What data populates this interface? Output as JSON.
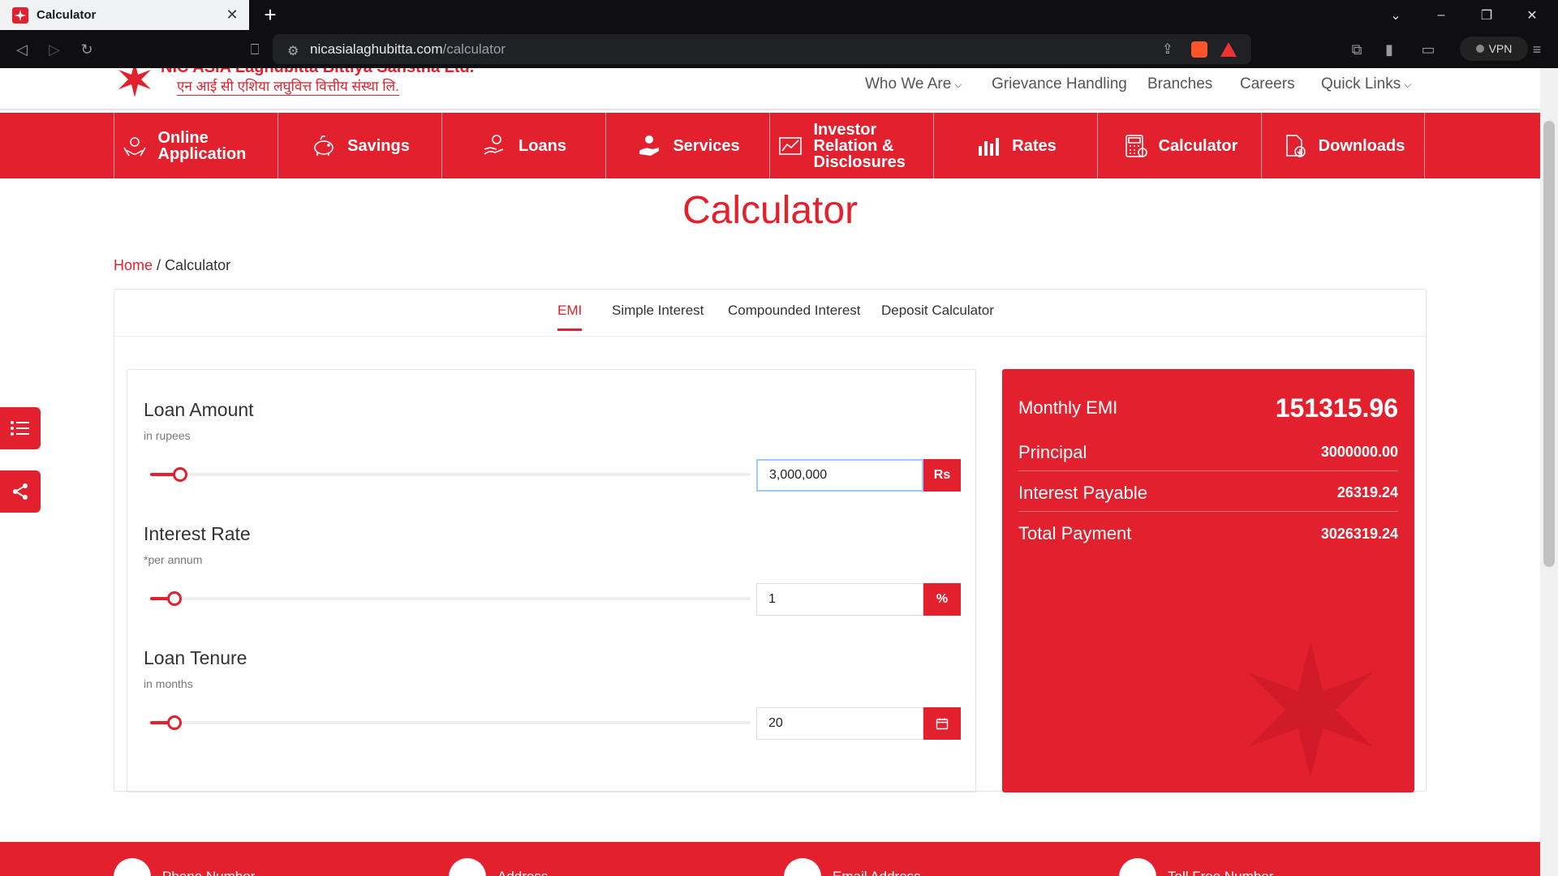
{
  "browser": {
    "tab_title": "Calculator",
    "new_tab": "+",
    "url_host": "nicasialaghubitta.com",
    "url_path": "/calculator",
    "vpn_label": "VPN"
  },
  "site": {
    "logo_line1": "NIC ASIA Laghubitta Bittiya Sanstha Ltd.",
    "logo_line2": "एन आई सी एशिया लघुवित्त वित्तीय संस्था लि."
  },
  "topnav": {
    "who_we_are": "Who We Are",
    "grievance": "Grievance Handling",
    "branches": "Branches",
    "careers": "Careers",
    "quick_links": "Quick Links"
  },
  "mainnav": {
    "online_application": "Online Application",
    "savings": "Savings",
    "loans": "Loans",
    "services": "Services",
    "investor_relation": "Investor Relation & Disclosures",
    "rates": "Rates",
    "calculator": "Calculator",
    "downloads": "Downloads"
  },
  "page": {
    "title": "Calculator",
    "breadcrumb_home": "Home",
    "breadcrumb_sep": "/",
    "breadcrumb_current": "Calculator"
  },
  "calc_tabs": {
    "emi": "EMI",
    "simple": "Simple Interest",
    "compounded": "Compounded Interest",
    "deposit": "Deposit Calculator"
  },
  "loan_amount": {
    "title": "Loan Amount",
    "sub": "in rupees",
    "value": "3,000,000",
    "addon": "Rs",
    "slider_fraction": 0.05
  },
  "interest_rate": {
    "title": "Interest Rate",
    "sub": "*per annum",
    "value": "1",
    "addon": "%",
    "slider_fraction": 0.04
  },
  "loan_tenure": {
    "title": "Loan Tenure",
    "sub": "in months",
    "value": "20",
    "slider_fraction": 0.03
  },
  "result": {
    "emi_label": "Monthly EMI",
    "emi_value": "151315.96",
    "principal_label": "Principal",
    "principal_value": "3000000.00",
    "interest_label": "Interest Payable",
    "interest_value": "26319.24",
    "total_label": "Total Payment",
    "total_value": "3026319.24"
  },
  "footer": {
    "phone": "Phone Number",
    "address": "Address",
    "email": "Email Address",
    "tollfree": "Toll Free Number"
  },
  "colors": {
    "brand_red": "#e3212e"
  }
}
